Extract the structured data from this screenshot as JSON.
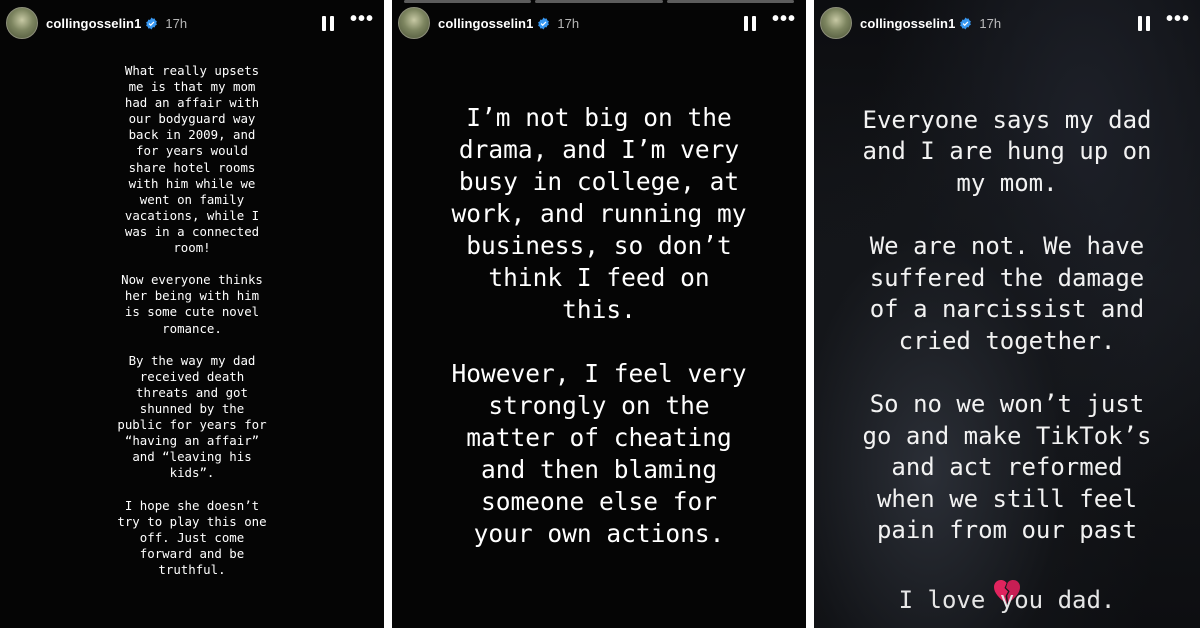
{
  "panels": [
    {
      "username": "collingosselin1",
      "time": "17h",
      "text": "What really upsets\nme is that my mom\nhad an affair with\nour bodyguard way\nback in 2009, and\nfor years would\nshare hotel rooms\nwith him while we\nwent on family\nvacations, while I\nwas in a connected\nroom!\n\nNow everyone thinks\nher being with him\nis some cute novel\nromance.\n\nBy the way my dad\nreceived death\nthreats and got\nshunned by the\npublic for years for\n“having an affair”\nand “leaving his\nkids”.\n\nI hope she doesn’t\ntry to play this one\noff. Just come\nforward and be\ntruthful."
    },
    {
      "username": "collingosselin1",
      "time": "17h",
      "text": "I’m not big on the\ndrama, and I’m very\nbusy in college, at\nwork, and running my\nbusiness, so don’t\nthink I feed on\nthis.\n\nHowever, I feel very\nstrongly on the\nmatter of cheating\nand then blaming\nsomeone else for\nyour own actions."
    },
    {
      "username": "collingosselin1",
      "time": "17h",
      "text": "Everyone says my dad\nand I are hung up on\nmy mom.\n\nWe are not. We have\nsuffered the damage\nof a narcissist and\ncried together.\n\nSo no we won’t just\ngo and make TikTok’s\nand act reformed\nwhen we still feel\npain from our past",
      "emoji": "broken-heart-icon",
      "closing": "I love you dad."
    }
  ],
  "icons": [
    "verified-badge-icon",
    "pause-icon",
    "more-options-icon"
  ],
  "colors": {
    "verified": "#3897f0",
    "background": "#050505",
    "text": "#ffffff",
    "heart": "#e0245e"
  }
}
